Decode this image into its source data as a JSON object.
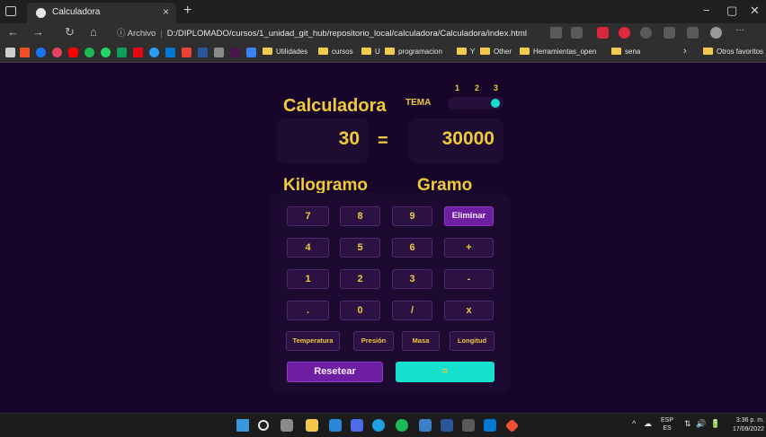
{
  "browser": {
    "tab_title": "Calculadora",
    "close_glyph": "×",
    "new_tab_glyph": "+",
    "window_controls": [
      "−",
      "▢",
      "✕"
    ],
    "nav_glyphs": {
      "back": "←",
      "forward": "→",
      "reload": "↻",
      "home": "⌂"
    },
    "address_info": "ⓘ Archivo",
    "address_url": "D:/DIPLOMADO/cursos/1_unidad_git_hub/repositorio_local/calculadora/Calculadora/index.html",
    "bookmarks": [
      "Utilidades",
      "cursos",
      "U",
      "programacion",
      "Y",
      "Other",
      "Herramientas_open",
      "sena"
    ],
    "bookmarks_more": "›",
    "other_favorites": "Otros favoritos"
  },
  "app": {
    "title": "Calculadora",
    "theme_label": "TEMA",
    "theme_options": [
      "1",
      "2",
      "3"
    ],
    "theme_selected": 3,
    "input_value": "30",
    "equals_sign": "=",
    "result_value": "30000",
    "from_unit": "Kilogramo",
    "to_unit": "Gramo",
    "keys": [
      [
        "7",
        "8",
        "9",
        "Eliminar"
      ],
      [
        "4",
        "5",
        "6",
        "+"
      ],
      [
        "1",
        "2",
        "3",
        "-"
      ],
      [
        ".",
        "0",
        "/",
        "x"
      ]
    ],
    "categories": [
      "Temperatura",
      "Presión",
      "Masa",
      "Longitud"
    ],
    "reset_label": "Resetear",
    "equals_label": "="
  },
  "taskbar": {
    "lang_top": "ESP",
    "lang_bottom": "ES",
    "time": "3:36 p. m.",
    "date": "17/09/2022",
    "tray_glyphs": [
      "^",
      "☁",
      "⇅",
      "🔊",
      "🔋"
    ]
  },
  "colors": {
    "background": "#17062a",
    "accent_yellow": "#f0c93c",
    "accent_purple": "#6e1ea1",
    "accent_cyan": "#16e0cd"
  }
}
